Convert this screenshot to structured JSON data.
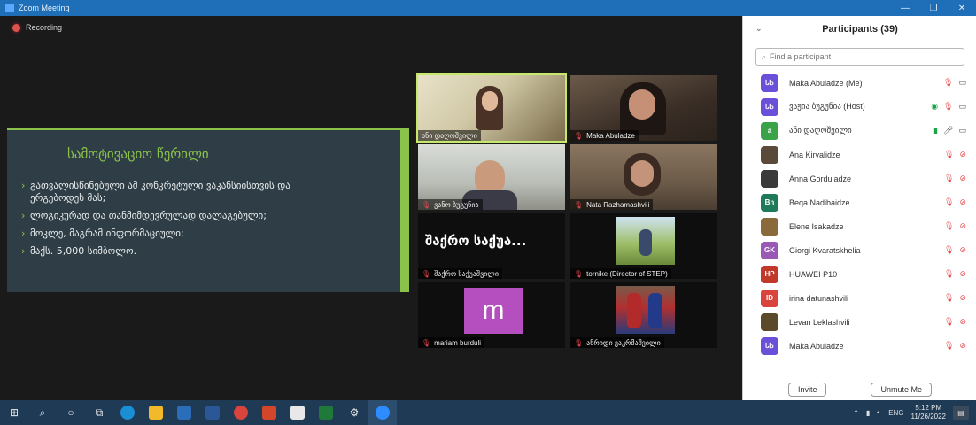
{
  "window": {
    "title": "Zoom Meeting",
    "controls": [
      "—",
      "❐",
      "✕"
    ]
  },
  "recording": {
    "label": "Recording"
  },
  "slide": {
    "title": "სამოტივაციო წერილი",
    "bullets": [
      "გათვალისწინებული ამ კონკრეტული ვაკანსიისთვის და ერგებოდეს მას;",
      "ლოგიკურად და თანმიმდევრულად დალაგებული;",
      "მოკლე, მაგრამ ინფორმაციული;",
      "მაქს. 5,000 სიმბოლო."
    ]
  },
  "tiles": [
    {
      "name": "ანი დაღოშვილი",
      "active": true
    },
    {
      "name": "Maka Abuladze"
    },
    {
      "name": "ვანო ბუგუნია"
    },
    {
      "name": "Nata Razhamashvili"
    },
    {
      "name": "შაქრო საქუაშვილი",
      "display": "შაქრო საქუა..."
    },
    {
      "name": "tornike (Director of STEP)"
    },
    {
      "name": "mariam burduli",
      "avatar_letter": "m"
    },
    {
      "name": "ანრიდი ვაკრმაშვილი"
    }
  ],
  "participants": {
    "title": "Participants (39)",
    "search_placeholder": "Find a participant",
    "people": [
      {
        "name": "Maka Abuladze (Me)",
        "initials": "ᏓᏏ",
        "color": "#6a4fd9",
        "mic": "off",
        "cam": "on"
      },
      {
        "name": "ვაჟია ბუგუნია (Host)",
        "initials": "ᏓᏏ",
        "color": "#6a4fd9",
        "mic": "off",
        "cam": "on",
        "extra": "◉"
      },
      {
        "name": "ანი დაღოშვილი",
        "initials": "a",
        "color": "#3aa34a",
        "mic": "on",
        "cam": "on",
        "extra": "▮"
      },
      {
        "name": "Ana Kirvalidze",
        "initials": "",
        "color": "#5a4a3a",
        "mic": "off",
        "cam": "off"
      },
      {
        "name": "Anna Gorduladze",
        "initials": "",
        "color": "#3a3a3a",
        "mic": "off",
        "cam": "off"
      },
      {
        "name": "Beqa Nadibaidze",
        "initials": "Bn",
        "color": "#1f7a5a",
        "mic": "off",
        "cam": "off"
      },
      {
        "name": "Elene Isakadze",
        "initials": "",
        "color": "#8a6a3a",
        "mic": "off",
        "cam": "off"
      },
      {
        "name": "Giorgi Kvaratskhelia",
        "initials": "GK",
        "color": "#9b59b6",
        "mic": "off",
        "cam": "off"
      },
      {
        "name": "HUAWEI P10",
        "initials": "HP",
        "color": "#c0392b",
        "mic": "off",
        "cam": "off"
      },
      {
        "name": "irina datunashvili",
        "initials": "ID",
        "color": "#d9443c",
        "mic": "off",
        "cam": "off"
      },
      {
        "name": "Levan Leklashvili",
        "initials": "",
        "color": "#5a4a2a",
        "mic": "off",
        "cam": "off"
      },
      {
        "name": "Maka Abuladze",
        "initials": "ᏓᏏ",
        "color": "#6a4fd9",
        "mic": "off",
        "cam": "off"
      }
    ],
    "invite_label": "Invite",
    "unmute_label": "Unmute Me"
  },
  "taskbar": {
    "tray_lang": "ENG",
    "time": "5:12 PM",
    "date": "11/26/2022"
  },
  "colors": {
    "accent": "#8bc34a",
    "titlebar": "#1e6fb8",
    "taskbar": "#1f3a55"
  }
}
